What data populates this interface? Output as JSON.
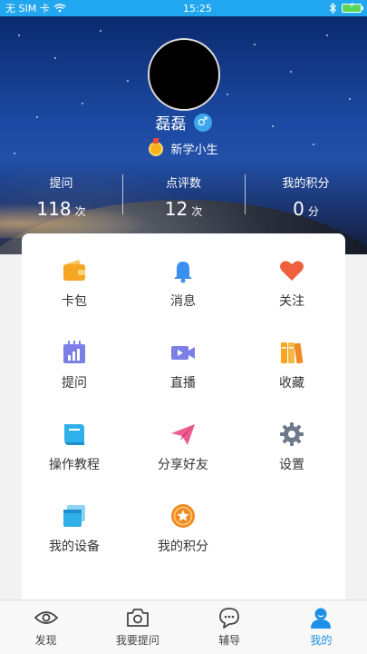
{
  "status_bar": {
    "carrier": "无 SIM 卡",
    "time": "15:25",
    "battery": "⚡"
  },
  "profile": {
    "username": "磊磊",
    "gender_symbol": "♂",
    "level": "新学小生"
  },
  "stats": [
    {
      "label": "提问",
      "value": "118",
      "unit": "次"
    },
    {
      "label": "点评数",
      "value": "12",
      "unit": "次"
    },
    {
      "label": "我的积分",
      "value": "0",
      "unit": "分"
    }
  ],
  "menu": [
    {
      "label": "卡包",
      "icon": "wallet-icon",
      "color": "#f6a623"
    },
    {
      "label": "消息",
      "icon": "bell-icon",
      "color": "#3b8ff0"
    },
    {
      "label": "关注",
      "icon": "heart-icon",
      "color": "#f0603c"
    },
    {
      "label": "提问",
      "icon": "calendar-chart-icon",
      "color": "#7d7fe8"
    },
    {
      "label": "直播",
      "icon": "video-camera-icon",
      "color": "#7d7fe8"
    },
    {
      "label": "收藏",
      "icon": "books-icon",
      "color": "#f6a623"
    },
    {
      "label": "操作教程",
      "icon": "book-icon",
      "color": "#2fb0e8"
    },
    {
      "label": "分享好友",
      "icon": "paper-plane-icon",
      "color": "#ef5b8f"
    },
    {
      "label": "设置",
      "icon": "gear-icon",
      "color": "#6c7a8c"
    },
    {
      "label": "我的设备",
      "icon": "device-icon",
      "color": "#2fb0e8"
    },
    {
      "label": "我的积分",
      "icon": "coin-star-icon",
      "color": "#f08a23"
    }
  ],
  "bottom_nav": [
    {
      "label": "发现",
      "icon": "eye-icon",
      "active": false
    },
    {
      "label": "我要提问",
      "icon": "camera-icon",
      "active": false
    },
    {
      "label": "辅导",
      "icon": "chat-icon",
      "active": false
    },
    {
      "label": "我的",
      "icon": "person-icon",
      "active": true
    }
  ],
  "colors": {
    "accent": "#1e8fe6",
    "status_bar": "#21a6f0"
  }
}
